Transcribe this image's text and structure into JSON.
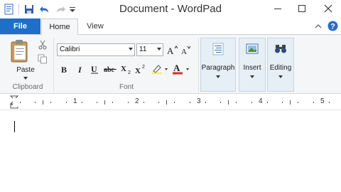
{
  "window": {
    "title": "Document - WordPad"
  },
  "quick_access": [
    {
      "icon": "save-icon"
    },
    {
      "icon": "undo-icon"
    },
    {
      "icon": "redo-icon"
    },
    {
      "icon": "customize-dropdown-icon"
    }
  ],
  "tabs": {
    "file": "File",
    "home": "Home",
    "view": "View"
  },
  "clipboard": {
    "paste_label": "Paste",
    "group_label": "Clipboard"
  },
  "font": {
    "family": "Calibri",
    "size": "11",
    "group_label": "Font"
  },
  "groups": {
    "paragraph": "Paragraph",
    "insert": "Insert",
    "editing": "Editing"
  },
  "ruler": {
    "numbers": [
      "1",
      "2",
      "3",
      "4",
      "5"
    ]
  },
  "colors": {
    "file_tab": "#1e6fc8",
    "ribbon_bg": "#f5f6f7",
    "group_highlight": "#e6eef6",
    "font_color": "#d32f2f"
  }
}
